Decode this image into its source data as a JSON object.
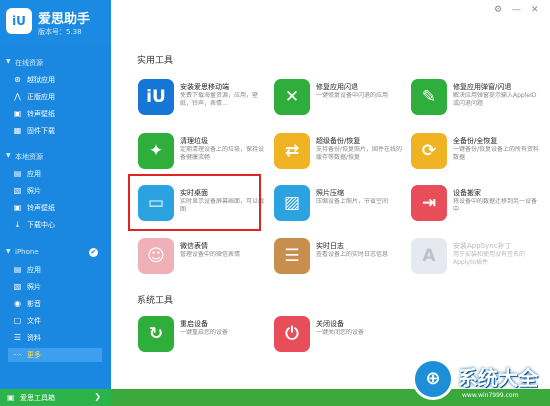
{
  "app": {
    "logo_text": "iU",
    "name": "爱思助手",
    "version": "版本号：5.38"
  },
  "window_controls": {
    "settings": "⚙",
    "minimize": "—",
    "close": "✕"
  },
  "sidebar": {
    "sections": [
      {
        "title": "在线资源",
        "items": [
          {
            "label": "越狱应用",
            "icon": "⊛"
          },
          {
            "label": "正版应用",
            "icon": "⋀"
          },
          {
            "label": "铃声壁纸",
            "icon": "▣"
          },
          {
            "label": "固件下载",
            "icon": "▦"
          }
        ]
      },
      {
        "title": "本地资源",
        "items": [
          {
            "label": "应用",
            "icon": "▤"
          },
          {
            "label": "照片",
            "icon": "▧"
          },
          {
            "label": "铃声壁纸",
            "icon": "▣"
          },
          {
            "label": "下载中心",
            "icon": "⤓"
          }
        ]
      },
      {
        "title": "iPhone",
        "check": "✔",
        "items": [
          {
            "label": "应用",
            "icon": "▤"
          },
          {
            "label": "照片",
            "icon": "▧"
          },
          {
            "label": "影音",
            "icon": "◉"
          },
          {
            "label": "文件",
            "icon": "▢"
          },
          {
            "label": "资料",
            "icon": "☰"
          },
          {
            "label": "更多",
            "icon": "⋯",
            "selected": true
          }
        ]
      }
    ],
    "footer": {
      "label": "爱思工具箱",
      "icon": "▣",
      "chevron": "❯"
    }
  },
  "main": {
    "practical_title": "实用工具",
    "system_title": "系统工具",
    "tools": [
      {
        "name": "安装爱思移动端",
        "desc": "免费下载海量资源，应用，壁纸，铃声，表情…",
        "color": "#1576d6",
        "icon": "iU"
      },
      {
        "name": "修复应用闪退",
        "desc": "一键修复设备中闪退的应用",
        "color": "#2fae3c",
        "icon": "✕"
      },
      {
        "name": "修复应用弹窗/闪退",
        "desc": "解决应用弹窗提示输入AppleID或闪退问题",
        "color": "#2fae3c",
        "icon": "✎"
      },
      {
        "name": "清理垃圾",
        "desc": "定期清理设备上的垃圾，保持设备健康流畅",
        "color": "#2fae3c",
        "icon": "✦"
      },
      {
        "name": "超级备份/恢复",
        "desc": "支持备份/恢复照片，固件在线的缓存等数据/恢复",
        "color": "#f0b323",
        "icon": "⇄"
      },
      {
        "name": "全备份/全恢复",
        "desc": "一键备份/恢复设备上的所有资料数据",
        "color": "#f0b323",
        "icon": "⟳"
      },
      {
        "name": "实时桌面",
        "desc": "实时显示设备屏幕画面，可以截图",
        "color": "#2aa3e0",
        "icon": "▭"
      },
      {
        "name": "照片压缩",
        "desc": "压缩设备上照片，节省空间",
        "color": "#2aa3e0",
        "icon": "▨"
      },
      {
        "name": "设备搬家",
        "desc": "将设备中的数据迁移到另一设备中",
        "color": "#e84d5a",
        "icon": "⇥"
      },
      {
        "name": "微信表情",
        "desc": "管理设备中的微信表情",
        "color": "#f0b0b8",
        "icon": "☺"
      },
      {
        "name": "实时日志",
        "desc": "查看设备上的实时日志信息",
        "color": "#c88e4e",
        "icon": "☰"
      },
      {
        "name": "安装AppSync补丁",
        "desc": "用于安装和使用没有签名的Applyto插件",
        "color": "#e6eaf0",
        "icon": "A",
        "disabled": true
      }
    ],
    "system_tools": [
      {
        "name": "重启设备",
        "desc": "一键重启您的设备",
        "color": "#2fae3c",
        "icon": "↻"
      },
      {
        "name": "关闭设备",
        "desc": "一键关闭您的设备",
        "color": "#e84d5a",
        "icon": "⏻"
      }
    ]
  },
  "watermark": {
    "logo_text": "⊕",
    "text": "系统大全",
    "url": "www.win7999.com"
  }
}
